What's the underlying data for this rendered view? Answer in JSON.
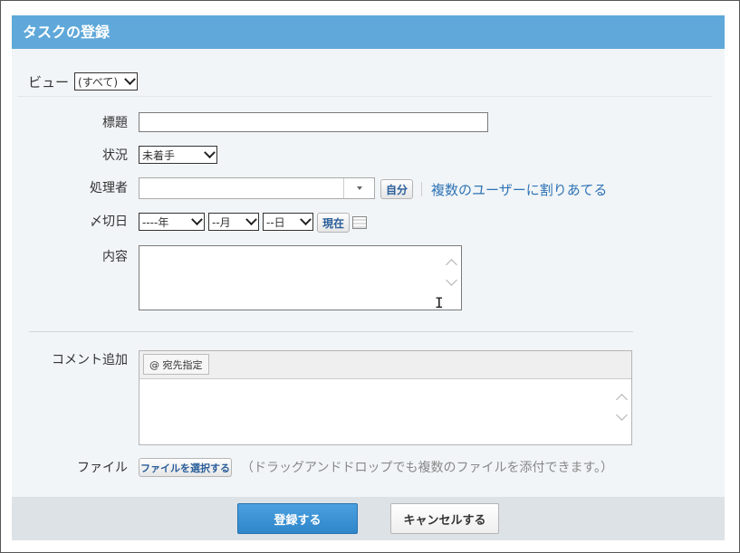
{
  "title": "タスクの登録",
  "view": {
    "label": "ビュー",
    "selected": "(すべて)"
  },
  "form": {
    "subject": {
      "label": "標題",
      "value": ""
    },
    "status": {
      "label": "状況",
      "selected": "未着手"
    },
    "assignee": {
      "label": "処理者",
      "value": "",
      "self_button": "自分",
      "multi_link": "複数のユーザーに割りあてる"
    },
    "due": {
      "label": "〆切日",
      "year": "----年",
      "month": "--月",
      "day": "--日",
      "now_button": "現在",
      "calendar_icon": "calendar-icon"
    },
    "content": {
      "label": "内容",
      "value": ""
    }
  },
  "comment": {
    "label": "コメント追加",
    "mention_button": "@ 宛先指定",
    "value": ""
  },
  "file": {
    "label": "ファイル",
    "select_button": "ファイルを選択する",
    "hint": "（ドラッグアンドドロップでも複数のファイルを添付できます。）"
  },
  "footer": {
    "submit": "登録する",
    "cancel": "キャンセルする"
  },
  "colors": {
    "title_bar": "#5fa8d9",
    "panel_bg": "#f1f5f7",
    "primary_button": "#3a93d4",
    "link": "#2f73b6"
  }
}
